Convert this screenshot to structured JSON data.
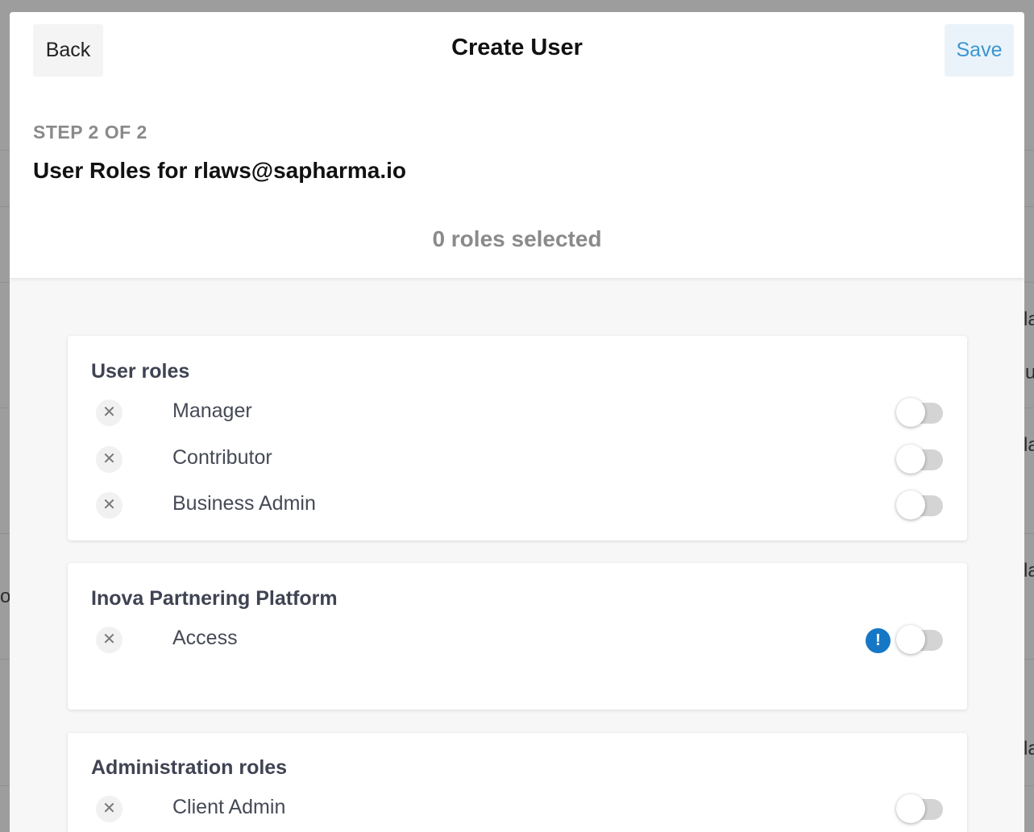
{
  "background": {
    "fragments": [
      "la",
      "u",
      "la",
      "la",
      "o",
      "la"
    ]
  },
  "header": {
    "back_label": "Back",
    "title": "Create User",
    "save_label": "Save",
    "step": "STEP 2 OF 2",
    "subtitle": "User Roles for rlaws@sapharma.io",
    "roles_selected": "0 roles selected"
  },
  "sections": [
    {
      "title": "User roles",
      "roles": [
        {
          "label": "Manager",
          "enabled": false
        },
        {
          "label": "Contributor",
          "enabled": false
        },
        {
          "label": "Business Admin",
          "enabled": false
        }
      ]
    },
    {
      "title": "Inova Partnering Platform",
      "roles": [
        {
          "label": "Access",
          "enabled": false,
          "icon": "info-exclamation-icon"
        }
      ]
    },
    {
      "title": "Administration roles",
      "roles": [
        {
          "label": "Client Admin",
          "enabled": false
        }
      ]
    }
  ],
  "icons": {
    "remove": "close-icon",
    "info": "info-exclamation-icon"
  },
  "colors": {
    "accent": "#3a96cf",
    "info": "#1677c6",
    "toggle_off": "#d4d4d4"
  }
}
